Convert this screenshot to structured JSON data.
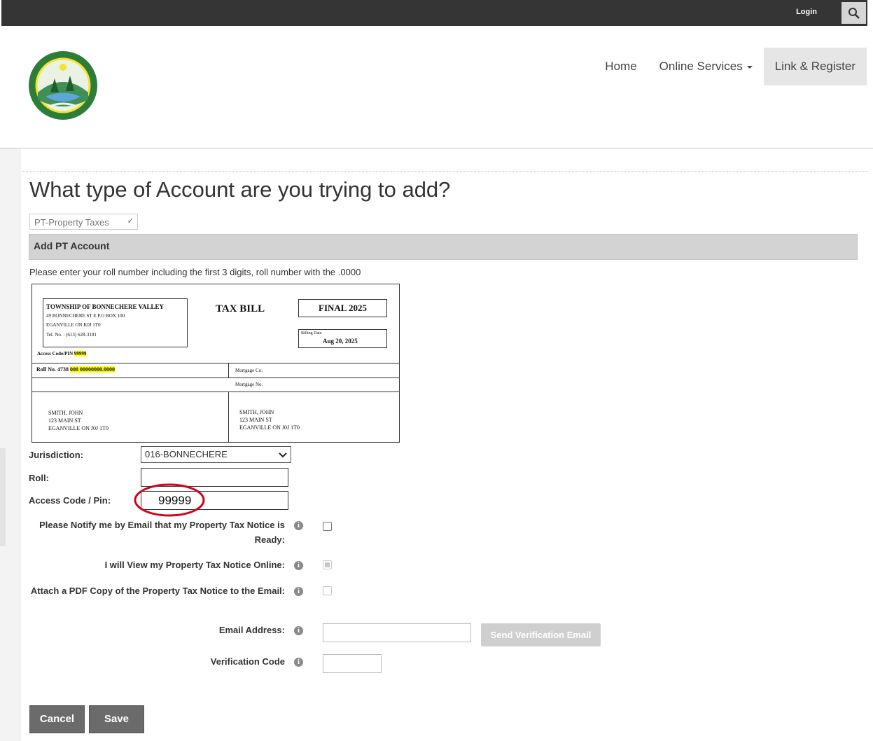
{
  "topbar": {
    "login_label": "Login",
    "search_icon": "search-icon"
  },
  "nav": {
    "home": "Home",
    "online_services": "Online Services",
    "link_register": "Link & Register"
  },
  "page": {
    "heading": "What type of Account are you trying to add?"
  },
  "account_type": {
    "selected": "PT-Property Taxes"
  },
  "section": {
    "title": "Add PT Account",
    "instructions": "Please enter your roll number including the first 3 digits, roll number with the .0000"
  },
  "bill": {
    "org": "TOWNSHIP OF BONNECHERE VALLEY",
    "addr1": "49 BONNECHERE ST E P.O BOX 100",
    "addr2": "EGANVILLE ON  K0J 1T0",
    "tel": "Tel. No. : (613) 628-3101",
    "title": "TAX BILL",
    "status": "FINAL 2025",
    "billing_date_label": "Billing Date",
    "billing_date": "Aug 20, 2025",
    "access_label": "Access Code/PIN",
    "access_value": "99999",
    "roll_label": "Roll No.  4738",
    "roll_value": "000 00000000.0000",
    "mortgage_co": "Mortgage Co:",
    "mortgage_no": "Mortgage No.",
    "owner1_name": "SMITH, JOHN",
    "owner1_street": "123 MAIN ST",
    "owner1_city": "EGANVILLE ON J0J 1T0",
    "owner2_name": "SMITH, JOHN",
    "owner2_street": "123 MAIN ST",
    "owner2_city": "EGANVILLE ON J0J 1T0"
  },
  "form": {
    "jurisdiction_label": "Jurisdiction:",
    "jurisdiction_value": "016-BONNECHERE",
    "roll_label": "Roll:",
    "roll_value": "",
    "access_label": "Access Code / Pin:",
    "access_value": "99999",
    "notify_label": "Please Notify me by Email that my Property Tax Notice is Ready:",
    "view_online_label": "I will View my Property Tax Notice Online:",
    "attach_pdf_label": "Attach a PDF Copy of the Property Tax Notice to the Email:",
    "email_label": "Email Address:",
    "email_value": "",
    "send_verification": "Send Verification Email",
    "verification_label": "Verification Code",
    "verification_value": "",
    "info_glyph": "i"
  },
  "buttons": {
    "cancel": "Cancel",
    "save": "Save"
  },
  "colors": {
    "topbar": "#353535",
    "highlight_circle": "#d0021b",
    "section_bg": "#d3d3d3",
    "button_bg": "#6b6b6b"
  }
}
